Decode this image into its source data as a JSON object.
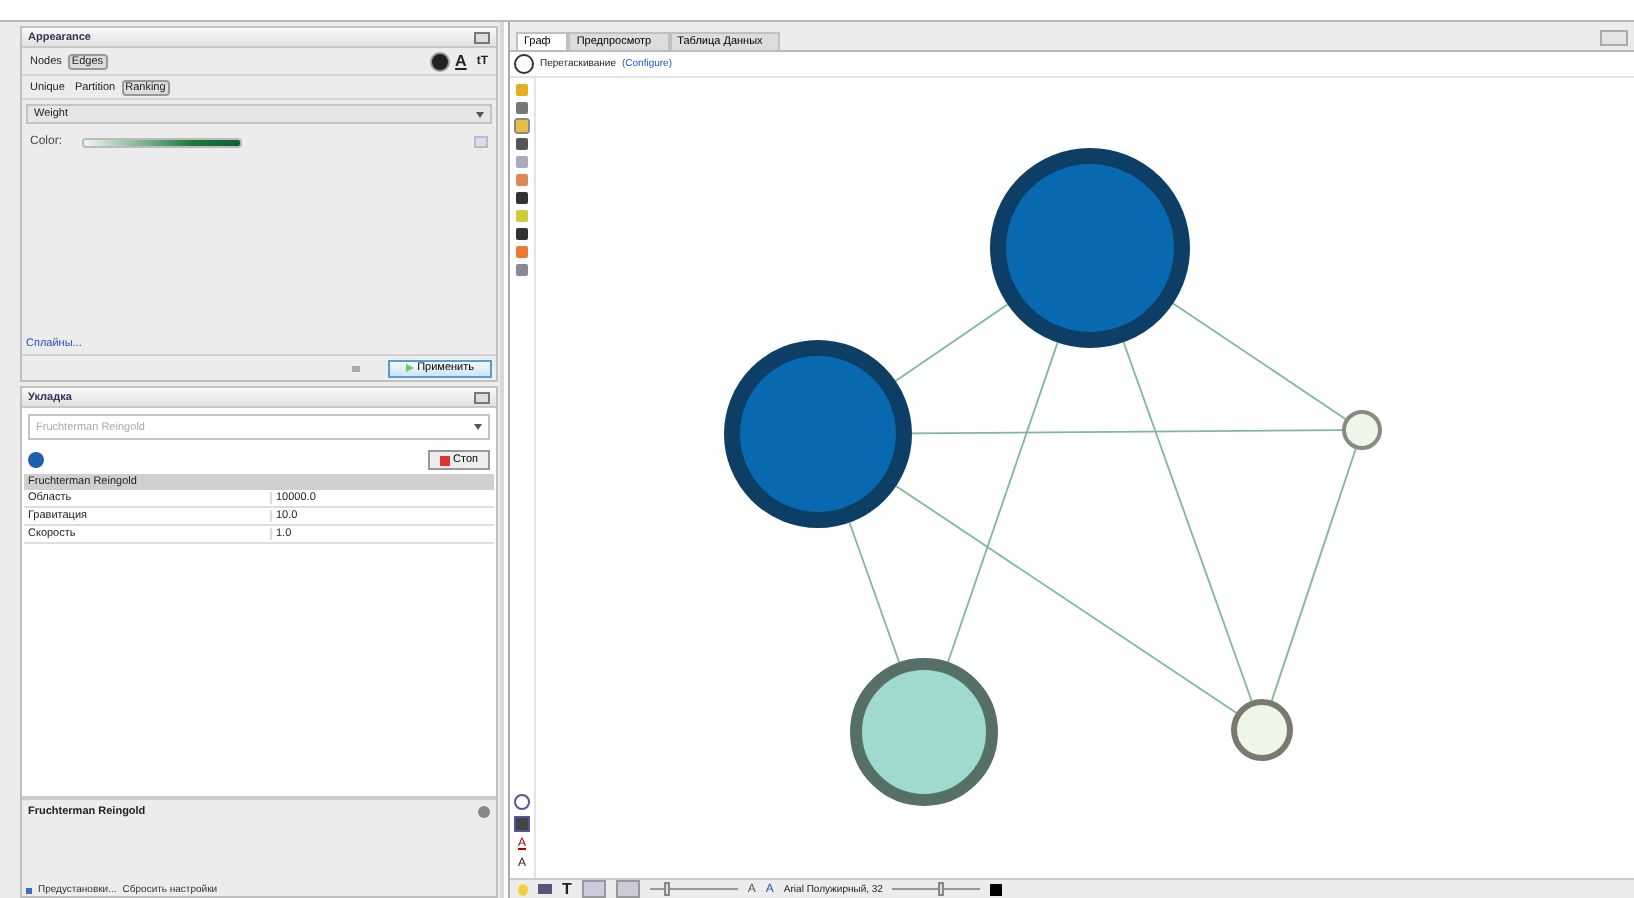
{
  "appearance": {
    "title": "Appearance",
    "element_tabs": [
      {
        "label": "Nodes",
        "selected": false
      },
      {
        "label": "Edges",
        "selected": true
      }
    ],
    "mode_tabs": [
      {
        "label": "Unique",
        "selected": false
      },
      {
        "label": "Partition",
        "selected": false
      },
      {
        "label": "Ranking",
        "selected": true
      }
    ],
    "text_color_glyph": "A",
    "text_size_glyph": "tT",
    "attribute": "Weight",
    "color_label": "Color:",
    "splines_link": "Сплайны...",
    "apply_button": "Применить"
  },
  "layout": {
    "title": "Укладка",
    "algorithm": "Fruchterman Reingold",
    "stop_button": "Стоп",
    "properties_header": "Fruchterman Reingold",
    "properties": [
      {
        "name": "Область",
        "value": "10000.0"
      },
      {
        "name": "Гравитация",
        "value": "10.0"
      },
      {
        "name": "Скорость",
        "value": "1.0"
      }
    ],
    "description_title": "Fruchterman Reingold",
    "presets_link": "Предустановки...",
    "reset_link": "Сбросить настройки"
  },
  "workspace": {
    "tabs": [
      {
        "label": "Граф",
        "selected": true
      },
      {
        "label": "Предпросмотр",
        "selected": false
      },
      {
        "label": "Таблица Данных",
        "selected": false
      }
    ],
    "tool_label": "Перетаскивание",
    "configure_link": "(Configure)",
    "side_glyphs": [
      "A",
      "A"
    ],
    "text_glyph": "T",
    "size_slider": {
      "level": 0.2
    },
    "font_glyphs": [
      "A",
      "A"
    ],
    "font_label": "Arial Полужирный, 32",
    "font_size_slider": {
      "level": 0.55
    }
  }
}
